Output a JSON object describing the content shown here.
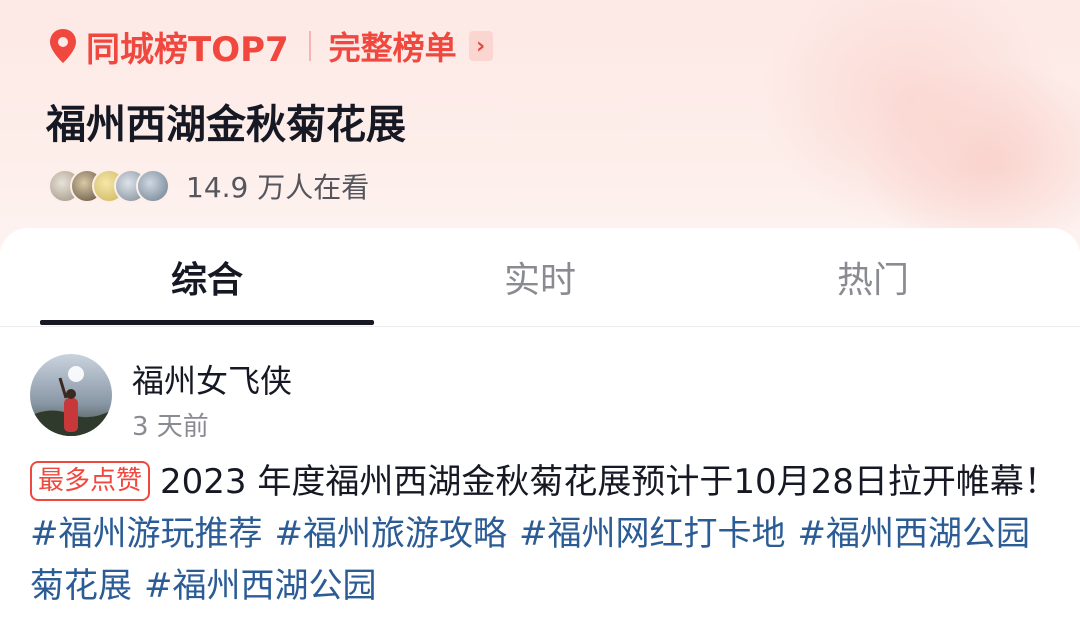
{
  "header": {
    "rank_label": "同城榜TOP7",
    "full_list_label": "完整榜单",
    "chevron": "›",
    "topic_title": "福州西湖金秋菊花展",
    "viewers_text": "14.9 万人在看",
    "icons": {
      "pin": "location-pin-icon",
      "chevron": "chevron-right-icon"
    },
    "accent_color": "#f0483e"
  },
  "tabs": [
    {
      "label": "综合",
      "active": true
    },
    {
      "label": "实时",
      "active": false
    },
    {
      "label": "热门",
      "active": false
    }
  ],
  "post": {
    "author": "福州女飞侠",
    "time": "3 天前",
    "badge": "最多点赞",
    "text": "2023 年度福州西湖金秋菊花展预计于10月28日拉开帷幕！",
    "hashtags": [
      "#福州游玩推荐",
      "#福州旅游攻略",
      "#福州网红打卡地",
      "#福州西湖公园菊花展",
      "#福州西湖公园"
    ],
    "link_color": "#2b5c95"
  }
}
